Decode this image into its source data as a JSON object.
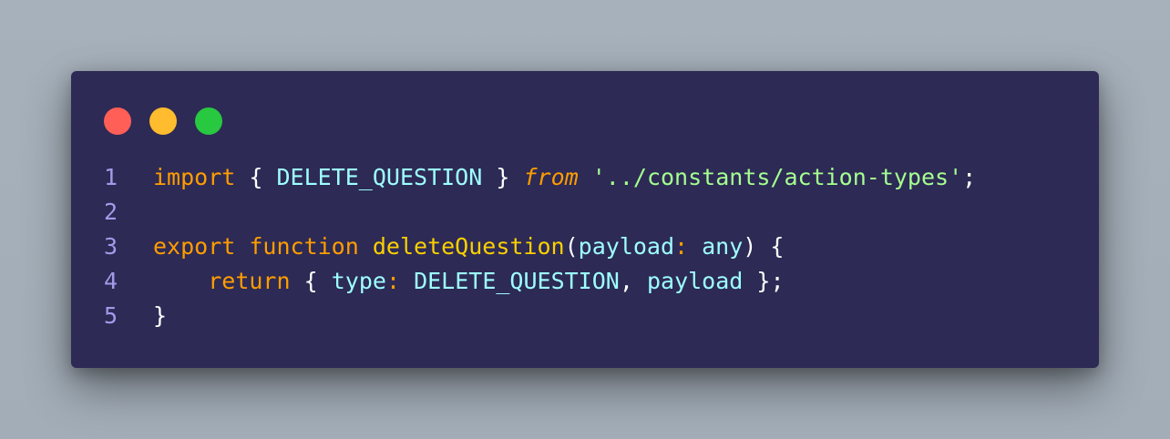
{
  "window": {
    "controls": [
      {
        "name": "close",
        "color": "#ff5f57"
      },
      {
        "name": "minimize",
        "color": "#febc2e"
      },
      {
        "name": "maximize",
        "color": "#28c840"
      }
    ]
  },
  "code": {
    "language": "typescript",
    "lines": [
      {
        "number": "1",
        "tokens": [
          {
            "text": "import",
            "kind": "kw-import"
          },
          {
            "text": " ",
            "kind": "txt"
          },
          {
            "text": "{",
            "kind": "punc"
          },
          {
            "text": " ",
            "kind": "txt"
          },
          {
            "text": "DELETE_QUESTION",
            "kind": "ident"
          },
          {
            "text": " ",
            "kind": "txt"
          },
          {
            "text": "}",
            "kind": "punc"
          },
          {
            "text": " ",
            "kind": "txt"
          },
          {
            "text": "from",
            "kind": "kw-from"
          },
          {
            "text": " ",
            "kind": "txt"
          },
          {
            "text": "'../constants/action-types'",
            "kind": "string"
          },
          {
            "text": ";",
            "kind": "punc"
          }
        ]
      },
      {
        "number": "2",
        "tokens": []
      },
      {
        "number": "3",
        "tokens": [
          {
            "text": "export",
            "kind": "kw-export"
          },
          {
            "text": " ",
            "kind": "txt"
          },
          {
            "text": "function",
            "kind": "kw-function"
          },
          {
            "text": " ",
            "kind": "txt"
          },
          {
            "text": "deleteQuestion",
            "kind": "fn"
          },
          {
            "text": "(",
            "kind": "punc"
          },
          {
            "text": "payload",
            "kind": "param"
          },
          {
            "text": ":",
            "kind": "colon"
          },
          {
            "text": " ",
            "kind": "txt"
          },
          {
            "text": "any",
            "kind": "type"
          },
          {
            "text": ")",
            "kind": "punc"
          },
          {
            "text": " ",
            "kind": "txt"
          },
          {
            "text": "{",
            "kind": "punc"
          }
        ]
      },
      {
        "number": "4",
        "tokens": [
          {
            "text": "    ",
            "kind": "txt"
          },
          {
            "text": "return",
            "kind": "kw-return"
          },
          {
            "text": " ",
            "kind": "txt"
          },
          {
            "text": "{",
            "kind": "punc"
          },
          {
            "text": " ",
            "kind": "txt"
          },
          {
            "text": "type",
            "kind": "param"
          },
          {
            "text": ":",
            "kind": "colon"
          },
          {
            "text": " ",
            "kind": "txt"
          },
          {
            "text": "DELETE_QUESTION",
            "kind": "ident"
          },
          {
            "text": ",",
            "kind": "punc"
          },
          {
            "text": " ",
            "kind": "txt"
          },
          {
            "text": "payload",
            "kind": "param"
          },
          {
            "text": " ",
            "kind": "txt"
          },
          {
            "text": "}",
            "kind": "punc"
          },
          {
            "text": ";",
            "kind": "punc"
          }
        ]
      },
      {
        "number": "5",
        "tokens": [
          {
            "text": "}",
            "kind": "punc"
          }
        ]
      }
    ]
  }
}
